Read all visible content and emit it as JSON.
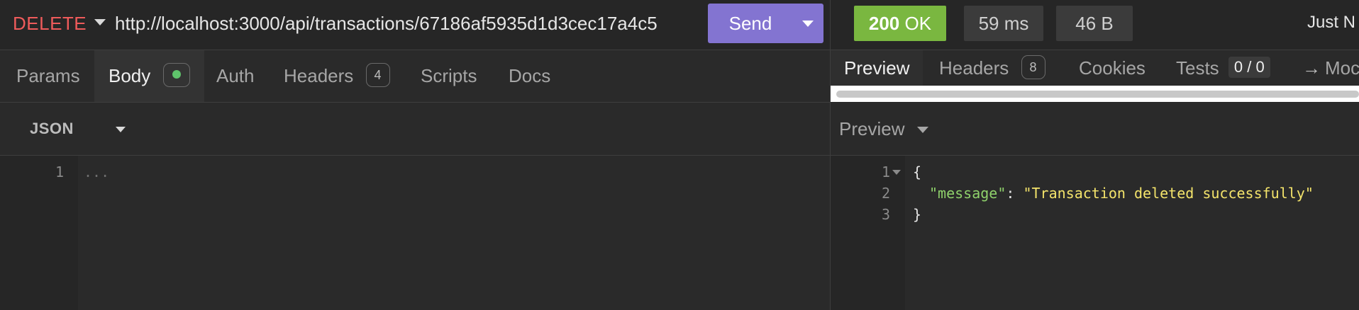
{
  "request": {
    "method": "DELETE",
    "url": "http://localhost:3000/api/transactions/67186af5935d1d3cec17a4c5",
    "send_label": "Send",
    "tabs": [
      {
        "label": "Params"
      },
      {
        "label": "Body"
      },
      {
        "label": "Auth"
      },
      {
        "label": "Headers",
        "badge": "4"
      },
      {
        "label": "Scripts"
      },
      {
        "label": "Docs"
      }
    ],
    "body_format": "JSON",
    "editor": {
      "line_numbers": [
        "1"
      ],
      "placeholder": "..."
    }
  },
  "response": {
    "status": {
      "code": "200",
      "text": "OK"
    },
    "time": "59 ms",
    "size": "46 B",
    "timestamp": "Just N",
    "tabs": [
      {
        "label": "Preview"
      },
      {
        "label": "Headers",
        "badge": "8"
      },
      {
        "label": "Cookies"
      },
      {
        "label": "Tests",
        "count": "0 / 0"
      },
      {
        "label": "Moc"
      }
    ],
    "preview_mode": "Preview",
    "body": {
      "line_numbers": [
        "1",
        "2",
        "3"
      ],
      "open_brace": "{",
      "key": "\"message\"",
      "colon": ": ",
      "value": "\"Transaction deleted successfully\"",
      "close_brace": "}"
    }
  },
  "colors": {
    "method_delete": "#ef5b5b",
    "send_button": "#8374d1",
    "status_ok": "#7ab740",
    "body_dot": "#5fc36b",
    "json_key": "#8fd16b",
    "json_string": "#f4e46b"
  }
}
